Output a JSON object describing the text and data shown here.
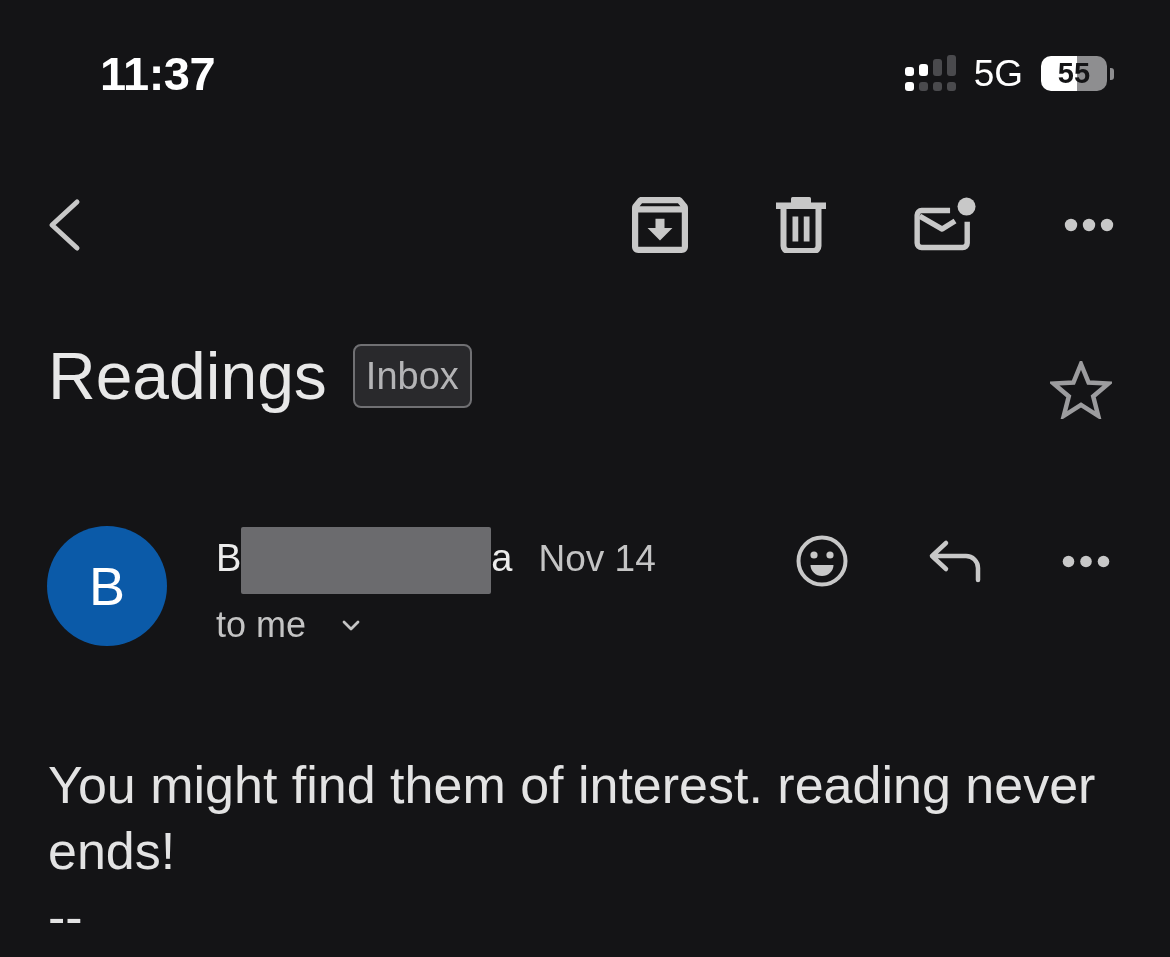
{
  "status_bar": {
    "time": "11:37",
    "network": "5G",
    "battery": "55"
  },
  "subject": {
    "title": "Readings",
    "label": "Inbox",
    "starred": false
  },
  "message": {
    "avatar_letter": "B",
    "sender": {
      "name_parts": [
        "B",
        "a"
      ],
      "redacted": true
    },
    "date": "Nov 14",
    "recipient": "to me",
    "body_lines": [
      "You might find them of interest. reading never ends!",
      "--"
    ]
  }
}
